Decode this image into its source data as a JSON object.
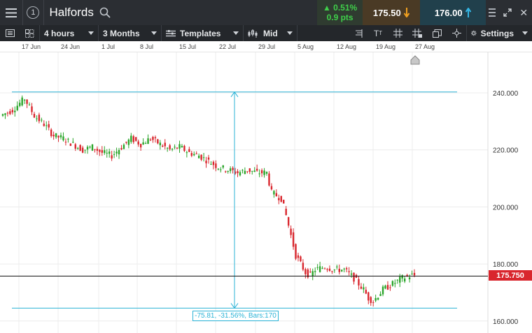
{
  "topbar": {
    "instrument": "Halfords",
    "change_pct": "0.51%",
    "change_pts": "0.9 pts",
    "sell_price": "175.50",
    "buy_price": "176.00"
  },
  "toolbar": {
    "interval": "4 hours",
    "range": "3 Months",
    "templates": "Templates",
    "price_type": "Mid",
    "settings": "Settings"
  },
  "colors": {
    "up": "#2aa52a",
    "down": "#d9262d",
    "accent": "#2bb3d6"
  },
  "chart_data": {
    "type": "candlestick",
    "dates": [
      "17 Jun",
      "24 Jun",
      "1 Jul",
      "8 Jul",
      "15 Jul",
      "22 Jul",
      "29 Jul",
      "5 Aug",
      "12 Aug",
      "19 Aug",
      "27 Aug"
    ],
    "y_ticks": [
      "240.000",
      "220.000",
      "200.000",
      "180.000",
      "160.000"
    ],
    "ylim": [
      157,
      250
    ],
    "current_price": 175.75,
    "current_price_label": "175.750",
    "measure": {
      "top": 240.3,
      "bottom": 164.5,
      "label": "-75.81, -31.56%, Bars:170"
    },
    "path": [
      [
        0,
        232
      ],
      [
        5,
        234
      ],
      [
        10,
        238
      ],
      [
        14,
        232
      ],
      [
        18,
        229
      ],
      [
        22,
        225
      ],
      [
        26,
        224
      ],
      [
        30,
        222
      ],
      [
        34,
        220
      ],
      [
        38,
        221
      ],
      [
        42,
        219
      ],
      [
        46,
        218
      ],
      [
        50,
        221
      ],
      [
        54,
        224
      ],
      [
        58,
        222
      ],
      [
        62,
        224
      ],
      [
        66,
        222
      ],
      [
        70,
        220
      ],
      [
        74,
        221
      ],
      [
        78,
        219
      ],
      [
        82,
        218
      ],
      [
        86,
        216
      ],
      [
        90,
        214
      ],
      [
        94,
        213
      ],
      [
        98,
        212
      ],
      [
        102,
        213
      ],
      [
        106,
        212
      ],
      [
        108,
        212
      ],
      [
        110,
        212
      ],
      [
        112,
        205
      ],
      [
        116,
        203
      ],
      [
        118,
        197
      ],
      [
        120,
        190
      ],
      [
        122,
        183
      ],
      [
        124,
        180
      ],
      [
        126,
        177
      ],
      [
        128,
        176
      ],
      [
        130,
        178
      ],
      [
        134,
        179
      ],
      [
        138,
        178
      ],
      [
        142,
        178
      ],
      [
        146,
        175
      ],
      [
        150,
        171
      ],
      [
        152,
        168
      ],
      [
        154,
        167
      ],
      [
        156,
        169
      ],
      [
        158,
        171
      ],
      [
        162,
        173
      ],
      [
        166,
        175
      ],
      [
        170,
        176
      ]
    ]
  }
}
